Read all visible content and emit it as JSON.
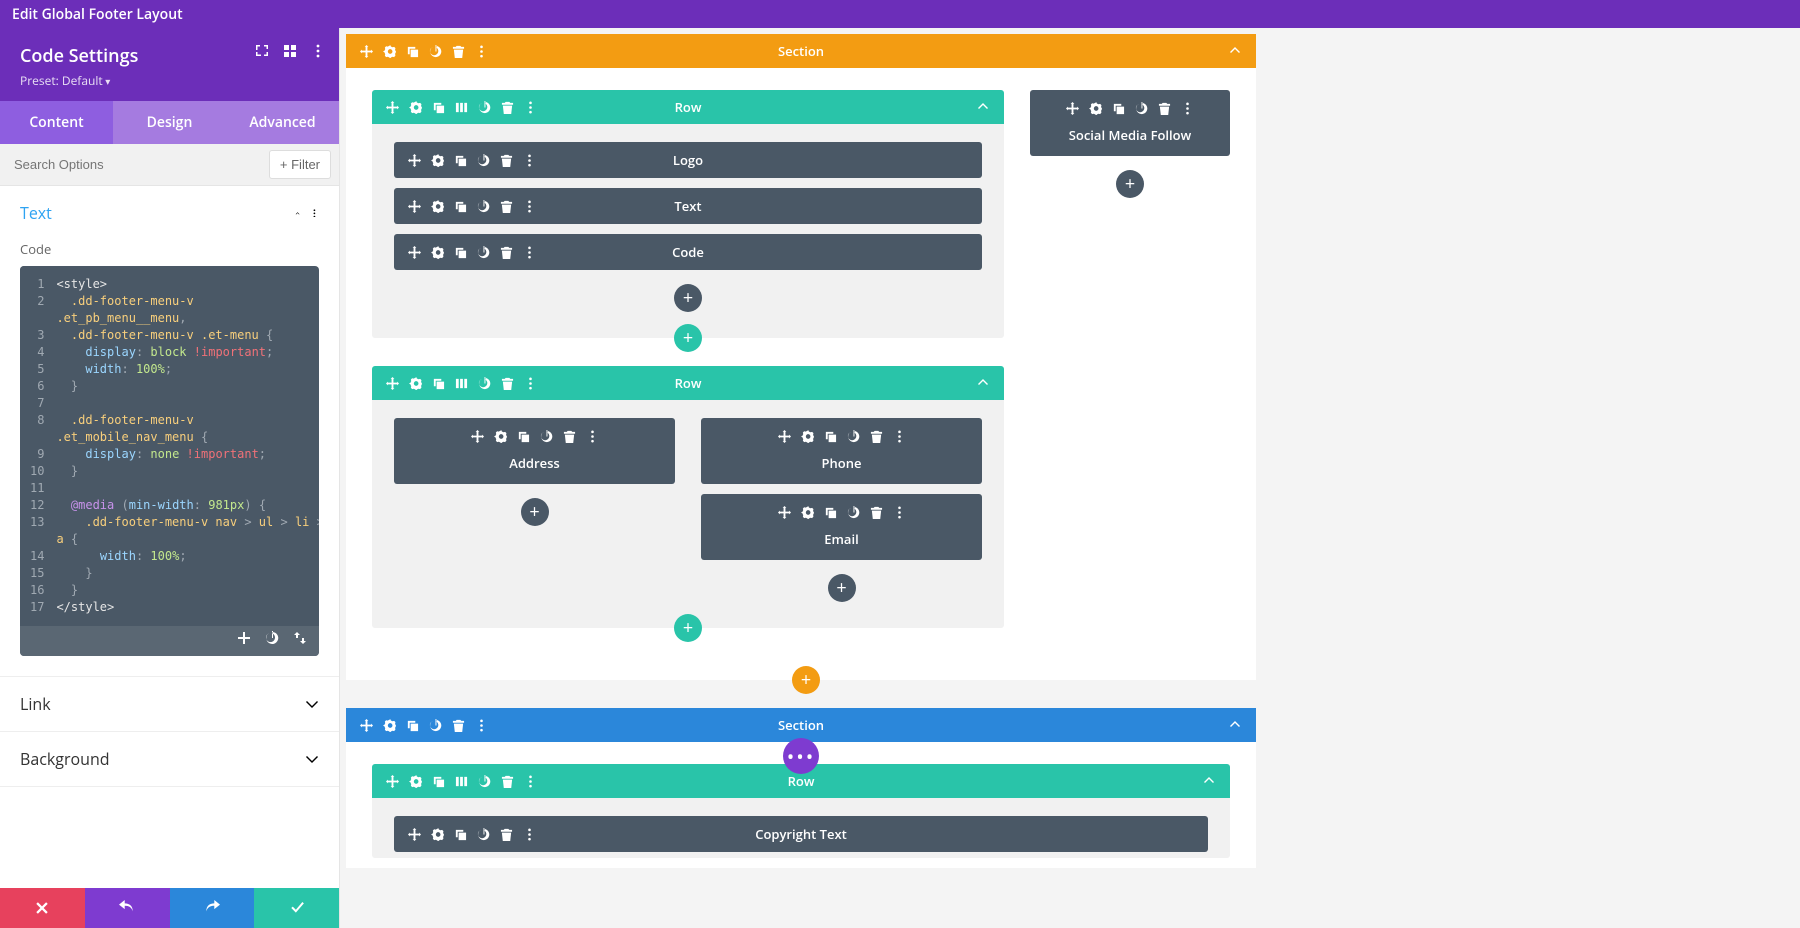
{
  "header": {
    "title": "Edit Global Footer Layout"
  },
  "sidebar": {
    "title": "Code Settings",
    "preset": "Preset: Default",
    "tabs": {
      "content": "Content",
      "design": "Design",
      "advanced": "Advanced"
    },
    "search_placeholder": "Search Options",
    "filter_label": "+ Filter",
    "acc": {
      "text": "Text",
      "link": "Link",
      "background": "Background"
    },
    "code_label": "Code",
    "code_lines": {
      "1": "<style>",
      "2": "  .dd-footer-menu-v .et_pb_menu__menu,",
      "3": "  .dd-footer-menu-v .et-menu {",
      "4": "    display: block !important;",
      "5": "    width: 100%;",
      "6": "  }",
      "7": "",
      "8": "  .dd-footer-menu-v .et_mobile_nav_menu {",
      "9": "    display: none !important;",
      "10": "  }",
      "11": "",
      "12": "  @media (min-width: 981px) {",
      "13": "    .dd-footer-menu-v nav > ul > li > a {",
      "14": "      width: 100%;",
      "15": "    }",
      "16": "  }",
      "17": "</style>"
    }
  },
  "canvas": {
    "section1": {
      "label": "Section",
      "row1": {
        "label": "Row",
        "modules": {
          "logo": "Logo",
          "text": "Text",
          "code": "Code"
        }
      },
      "social": {
        "label": "Social Media Follow"
      },
      "row2": {
        "label": "Row",
        "modules": {
          "address": "Address",
          "phone": "Phone",
          "email": "Email"
        }
      }
    },
    "section2": {
      "label": "Section",
      "row1": {
        "label": "Row",
        "module": "Copyright Text"
      }
    }
  }
}
